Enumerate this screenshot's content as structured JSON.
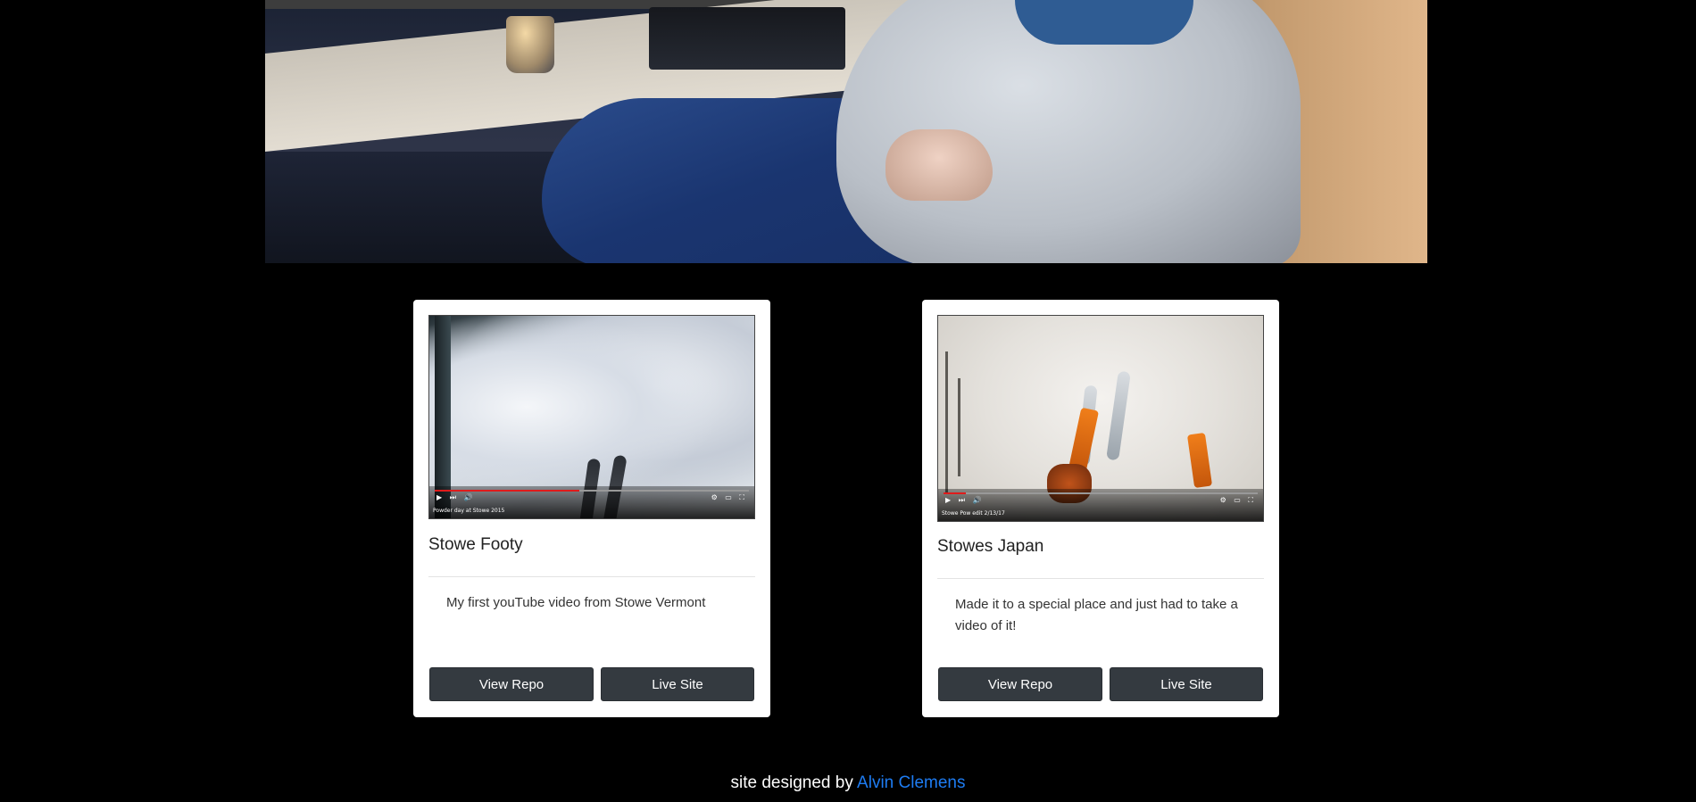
{
  "hero": {
    "image_alt": "person seated at a desk with a keyboard and mug"
  },
  "projects": [
    {
      "title": "Stowe Footy",
      "description": "My first youTube video from Stowe Vermont",
      "video": {
        "caption": "Powder day at Stowe 2015",
        "progress_fraction": 0.46
      },
      "buttons": {
        "repo": "View Repo",
        "live": "Live Site"
      }
    },
    {
      "title": "Stowes Japan",
      "description": "Made it to a special place and just had to take a video of it!",
      "video": {
        "caption": "Stowe Pow edit 2/13/17",
        "progress_fraction": 0.07
      },
      "buttons": {
        "repo": "View Repo",
        "live": "Live Site"
      }
    }
  ],
  "footer": {
    "prefix": "site designed by ",
    "author": "Alvin Clemens",
    "link_color": "#1e7cf2"
  },
  "colors": {
    "background": "#000000",
    "card": "#ffffff",
    "button": "#343a40",
    "progress": "#e01b1b"
  }
}
